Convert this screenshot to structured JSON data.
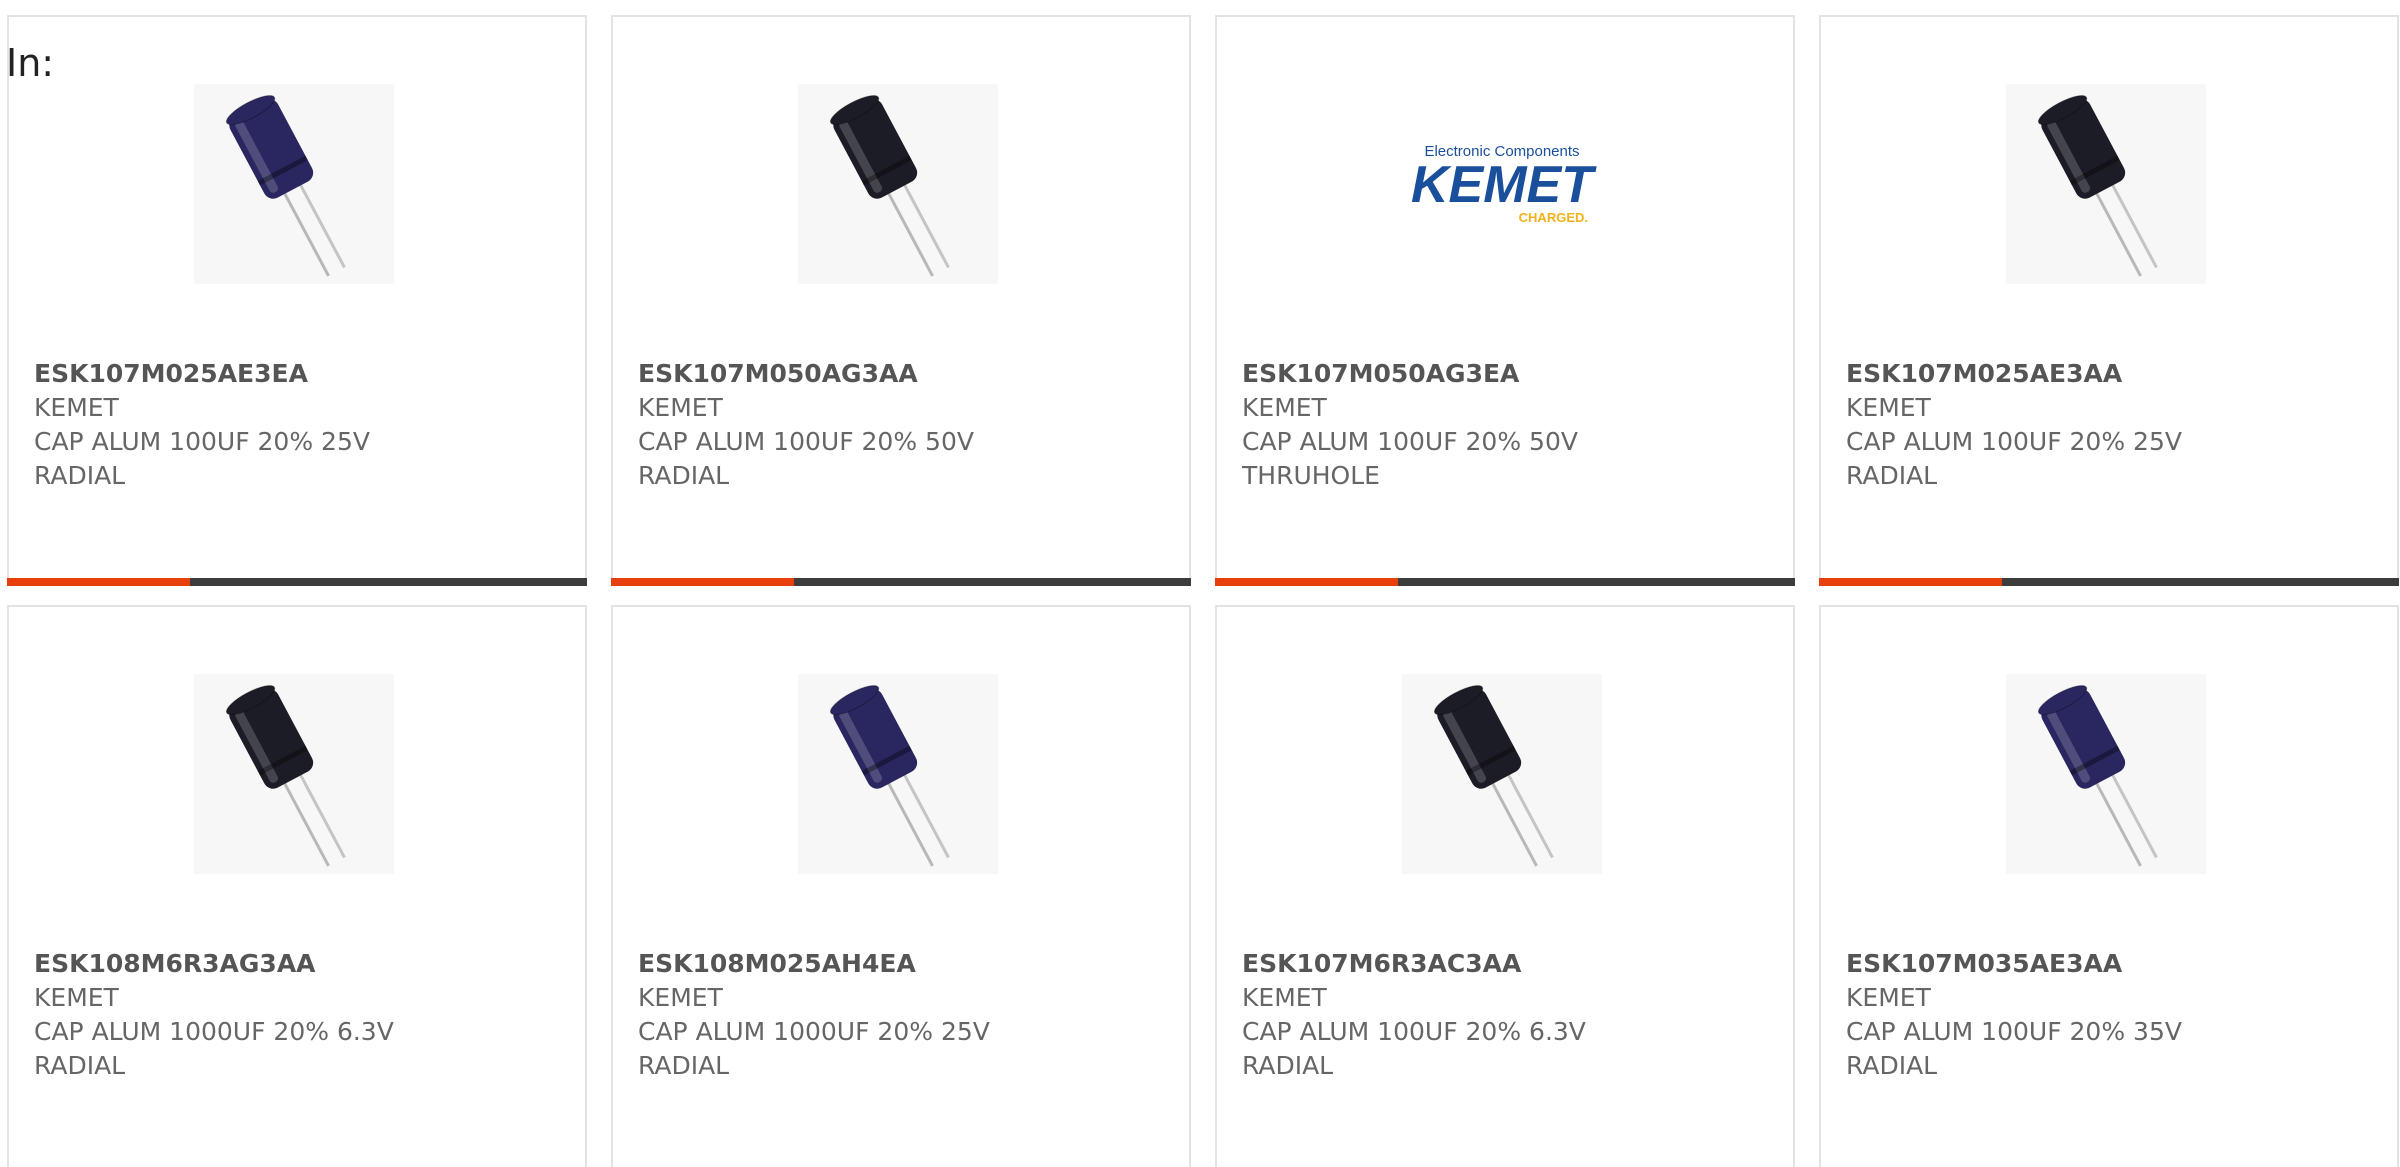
{
  "header": {
    "prefix": "In:"
  },
  "products": [
    {
      "part_number": "ESK107M025AE3EA",
      "manufacturer": "KEMET",
      "description": "CAP ALUM 100UF 20% 25V",
      "mounting": "RADIAL",
      "image": "capacitor-navy"
    },
    {
      "part_number": "ESK107M050AG3AA",
      "manufacturer": "KEMET",
      "description": "CAP ALUM 100UF 20% 50V",
      "mounting": "RADIAL",
      "image": "capacitor-black"
    },
    {
      "part_number": "ESK107M050AG3EA",
      "manufacturer": "KEMET",
      "description": "CAP ALUM 100UF 20% 50V",
      "mounting": "THRUHOLE",
      "image": "kemet-logo",
      "logo": {
        "top": "Electronic Components",
        "main": "KEMET",
        "sub": "CHARGED."
      }
    },
    {
      "part_number": "ESK107M025AE3AA",
      "manufacturer": "KEMET",
      "description": "CAP ALUM 100UF 20% 25V",
      "mounting": "RADIAL",
      "image": "capacitor-black"
    },
    {
      "part_number": "ESK108M6R3AG3AA",
      "manufacturer": "KEMET",
      "description": "CAP ALUM 1000UF 20% 6.3V",
      "mounting": "RADIAL",
      "image": "capacitor-black"
    },
    {
      "part_number": "ESK108M025AH4EA",
      "manufacturer": "KEMET",
      "description": "CAP ALUM 1000UF 20% 25V",
      "mounting": "RADIAL",
      "image": "capacitor-navy"
    },
    {
      "part_number": "ESK107M6R3AC3AA",
      "manufacturer": "KEMET",
      "description": "CAP ALUM 100UF 20% 6.3V",
      "mounting": "RADIAL",
      "image": "capacitor-black"
    },
    {
      "part_number": "ESK107M035AE3AA",
      "manufacturer": "KEMET",
      "description": "CAP ALUM 100UF 20% 35V",
      "mounting": "RADIAL",
      "image": "capacitor-navy"
    }
  ],
  "colors": {
    "accent": "#e8400c",
    "bar": "#3c3c3c",
    "capacitor_navy": "#2a2660",
    "capacitor_black": "#1c1c26",
    "logo_blue": "#1a4f9c",
    "logo_yellow": "#f2b21b"
  }
}
